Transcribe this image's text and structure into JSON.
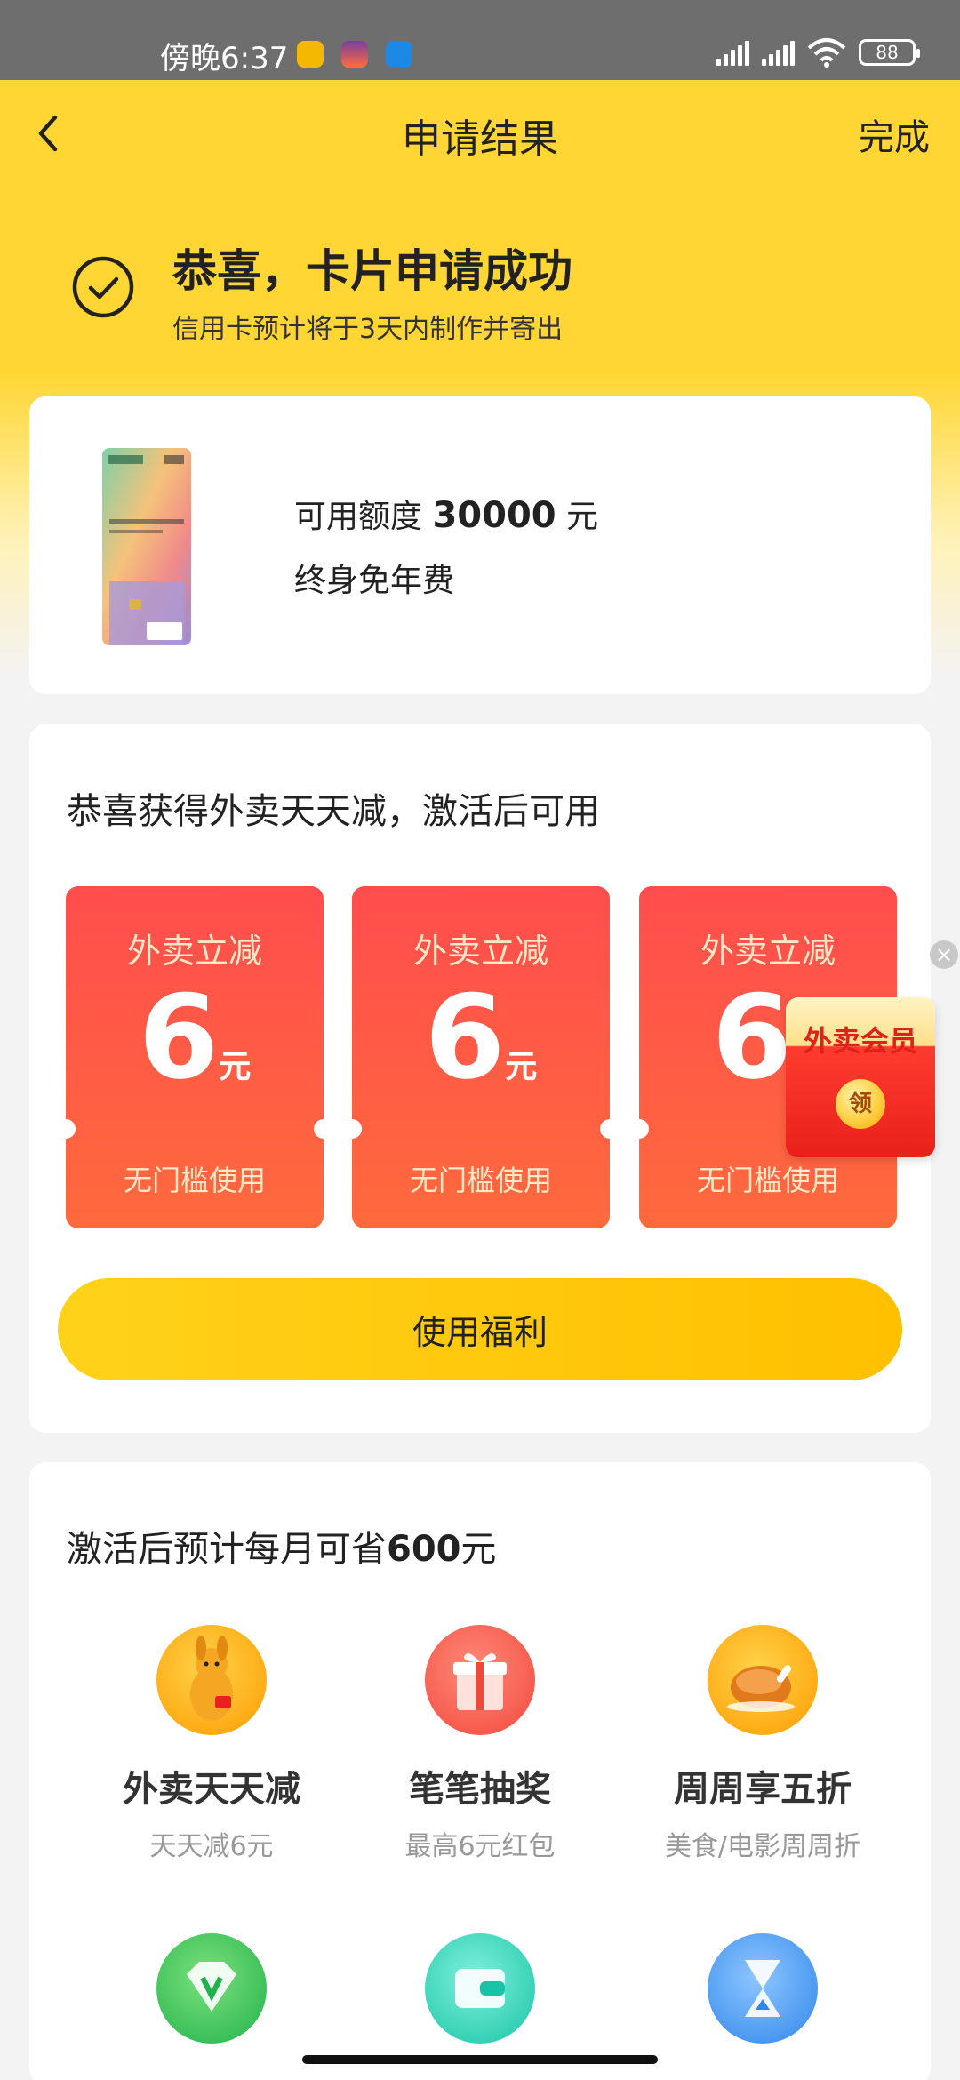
{
  "status_bar": {
    "time": "傍晚6:37",
    "battery": "88"
  },
  "nav": {
    "title": "申请结果",
    "done_label": "完成"
  },
  "success": {
    "title": "恭喜，卡片申请成功",
    "subtitle": "信用卡预计将于3天内制作并寄出"
  },
  "card_info": {
    "limit_prefix": "可用额度",
    "limit_amount": "30000",
    "limit_unit": "元",
    "fee_text": "终身免年费"
  },
  "coupons": {
    "title": "恭喜获得外卖天天减，激活后可用",
    "items": [
      {
        "label": "外卖立减",
        "amount": "6",
        "unit": "元",
        "condition": "无门槛使用"
      },
      {
        "label": "外卖立减",
        "amount": "6",
        "unit": "元",
        "condition": "无门槛使用"
      },
      {
        "label": "外卖立减",
        "amount": "6",
        "unit": "元",
        "condition": "无门槛使用"
      }
    ],
    "button_label": "使用福利"
  },
  "float_ad": {
    "label": "外卖会员",
    "coin_text": "领"
  },
  "savings": {
    "title_prefix": "激活后预计每月可省",
    "title_amount": "600",
    "title_suffix": "元",
    "items": [
      {
        "title": "外卖天天减",
        "subtitle": "天天减6元",
        "icon": "kangaroo-icon"
      },
      {
        "title": "笔笔抽奖",
        "subtitle": "最高6元红包",
        "icon": "gift-icon"
      },
      {
        "title": "周周享五折",
        "subtitle": "美食/电影周周折",
        "icon": "roast-chicken-icon"
      }
    ],
    "more_icons": [
      "diamond-icon",
      "wallet-icon",
      "hourglass-icon"
    ]
  },
  "colors": {
    "brand_yellow": "#ffd633",
    "coupon_red": "#ff4d4d",
    "button_yellow": "#ffc000"
  }
}
